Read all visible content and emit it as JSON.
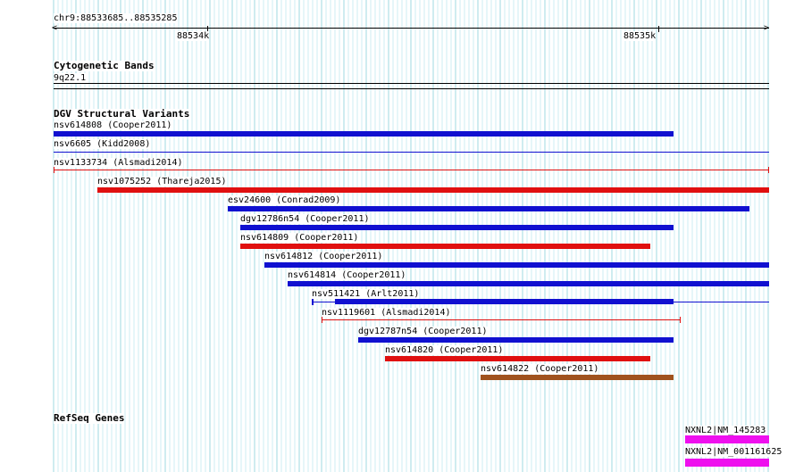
{
  "ruler": {
    "range_label": "chr9:88533685..88535285",
    "ticks": [
      "88534k",
      "88535k"
    ]
  },
  "sections": {
    "cytobands": {
      "title": "Cytogenetic Bands",
      "band": "9q22.1"
    },
    "dgv": {
      "title": "DGV Structural Variants",
      "features": [
        {
          "label": "nsv614808 (Cooper2011)",
          "color": "#1010d0",
          "style": "thick"
        },
        {
          "label": "nsv6605 (Kidd2008)",
          "color": "#1010d0",
          "style": "thin"
        },
        {
          "label": "nsv1133734 (Alsmadi2014)",
          "color": "#e01010",
          "style": "thin-capped"
        },
        {
          "label": "nsv1075252 (Thareja2015)",
          "color": "#e01010",
          "style": "thick"
        },
        {
          "label": "esv24600 (Conrad2009)",
          "color": "#1010d0",
          "style": "thick"
        },
        {
          "label": "dgv12786n54 (Cooper2011)",
          "color": "#1010d0",
          "style": "thick"
        },
        {
          "label": "nsv614809 (Cooper2011)",
          "color": "#e01010",
          "style": "thick"
        },
        {
          "label": "nsv614812 (Cooper2011)",
          "color": "#1010d0",
          "style": "thick"
        },
        {
          "label": "nsv614814 (Cooper2011)",
          "color": "#1010d0",
          "style": "thick"
        },
        {
          "label": "nsv511421 (Arlt2011)",
          "color": "#1010d0",
          "style": "mixed"
        },
        {
          "label": "nsv1119601 (Alsmadi2014)",
          "color": "#e01010",
          "style": "thin-capped"
        },
        {
          "label": "dgv12787n54 (Cooper2011)",
          "color": "#1010d0",
          "style": "thick"
        },
        {
          "label": "nsv614820 (Cooper2011)",
          "color": "#e01010",
          "style": "thick"
        },
        {
          "label": "nsv614822 (Cooper2011)",
          "color": "#a0521e",
          "style": "thick"
        }
      ]
    },
    "refseq": {
      "title": "RefSeq Genes",
      "genes": [
        {
          "label": "NXNL2|NM_145283",
          "color": "#ee10ee"
        },
        {
          "label": "NXNL2|NM_001161625",
          "color": "#ee10ee"
        }
      ]
    }
  }
}
